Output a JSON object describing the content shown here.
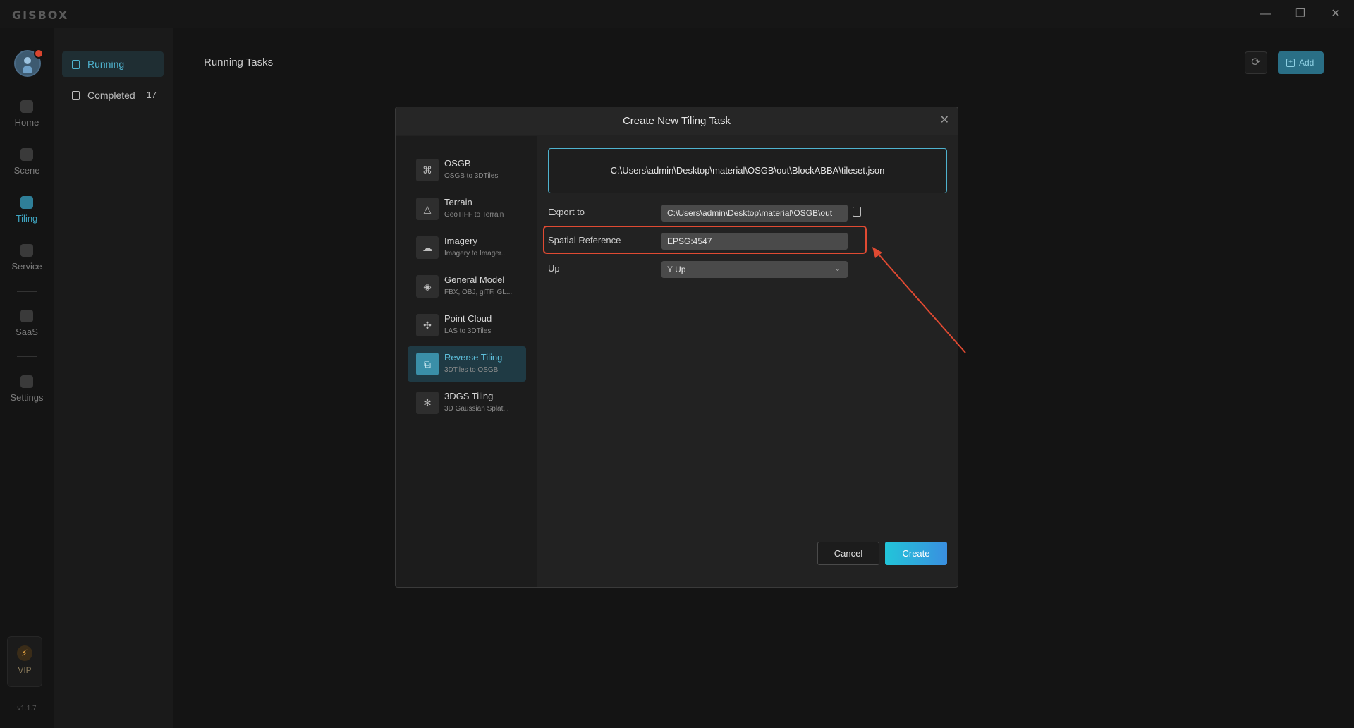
{
  "app": {
    "brand": "GISBOX",
    "version": "v1.1.7"
  },
  "window_controls": {
    "minimize": "—",
    "restore": "❐",
    "close": "✕"
  },
  "nav": {
    "items": [
      {
        "label": "Home"
      },
      {
        "label": "Scene"
      },
      {
        "label": "Tiling"
      },
      {
        "label": "Service"
      },
      {
        "label": "SaaS"
      },
      {
        "label": "Settings"
      }
    ],
    "vip_label": "VIP",
    "vip_icon": "⚡"
  },
  "subnav": {
    "running_label": "Running",
    "completed_label": "Completed",
    "completed_count": "17"
  },
  "main": {
    "title": "Running Tasks",
    "refresh_icon": "⟳",
    "add_label": "Add",
    "add_icon": "+"
  },
  "dialog": {
    "title": "Create New Tiling Task",
    "close_icon": "✕",
    "types": [
      {
        "name": "OSGB",
        "desc": "OSGB to 3DTiles",
        "icon": "⌘"
      },
      {
        "name": "Terrain",
        "desc": "GeoTIFF to Terrain",
        "icon": "△"
      },
      {
        "name": "Imagery",
        "desc": "Imagery to Imager...",
        "icon": "☁"
      },
      {
        "name": "General Model",
        "desc": "FBX, OBJ, glTF, GL...",
        "icon": "◈"
      },
      {
        "name": "Point Cloud",
        "desc": "LAS to 3DTiles",
        "icon": "✣"
      },
      {
        "name": "Reverse Tiling",
        "desc": "3DTiles to OSGB",
        "icon": "⧉"
      },
      {
        "name": "3DGS Tiling",
        "desc": "3D Gaussian Splat...",
        "icon": "✻"
      }
    ],
    "source_path": "C:\\Users\\admin\\Desktop\\material\\OSGB\\out\\BlockABBA\\tileset.json",
    "export_label": "Export to",
    "export_value": "C:\\Users\\admin\\Desktop\\material\\OSGB\\out",
    "spatial_label": "Spatial Reference",
    "spatial_value": "EPSG:4547",
    "up_label": "Up",
    "up_value": "Y Up",
    "up_chevron": "⌄",
    "cancel_label": "Cancel",
    "create_label": "Create"
  },
  "colors": {
    "accent": "#4fb3cf",
    "highlight": "#e04a32"
  }
}
